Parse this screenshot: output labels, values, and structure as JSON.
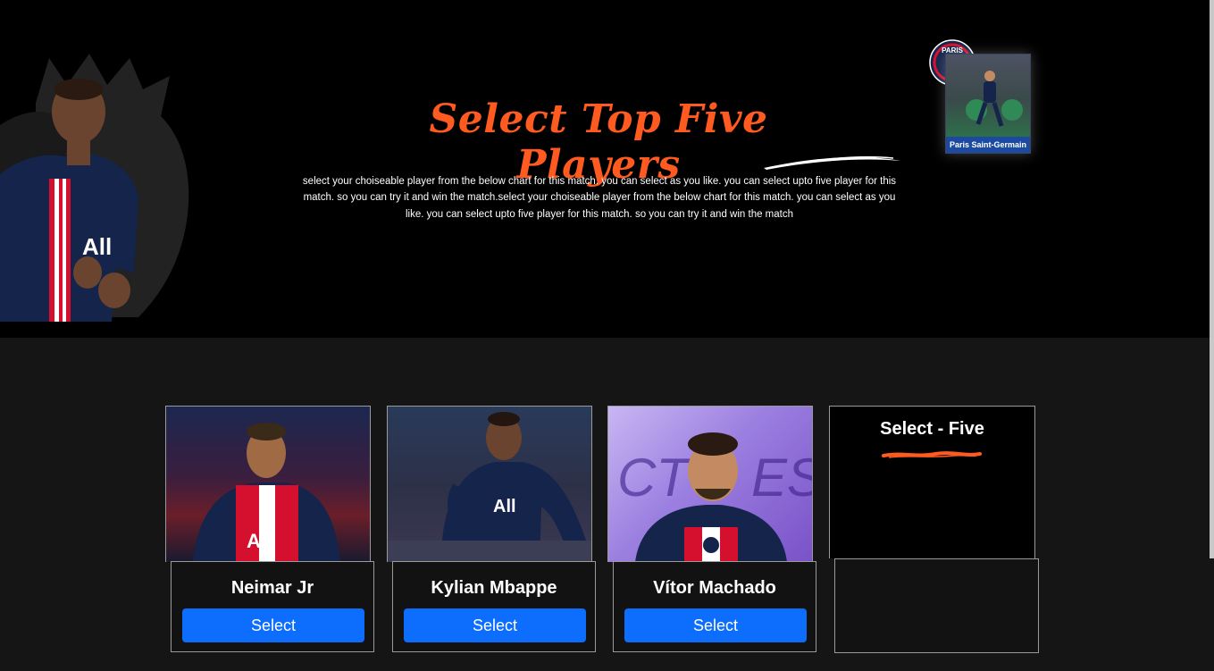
{
  "hero": {
    "title": "Select Top Five Players",
    "description": "select your choiseable player from the below chart for this match. you can select as you like. you can select upto five player for this match. so you can try it and win the match.select your choiseable player from the below chart for this match. you can select as you like. you can select upto five player for this match. so you can try it and win the match",
    "club_badge_text": "PARIS",
    "club_card_caption": "Paris Saint-Germain"
  },
  "players": [
    {
      "name": "Neimar Jr",
      "button_label": "Select"
    },
    {
      "name": "Kylian Mbappe",
      "button_label": "Select"
    },
    {
      "name": "Vítor Machado",
      "button_label": "Select"
    }
  ],
  "selection_panel": {
    "title": "Select - Five"
  },
  "colors": {
    "accent": "#ff5a1f",
    "button": "#0d6efd",
    "psg_navy": "#14244a",
    "psg_red": "#d5102f"
  }
}
